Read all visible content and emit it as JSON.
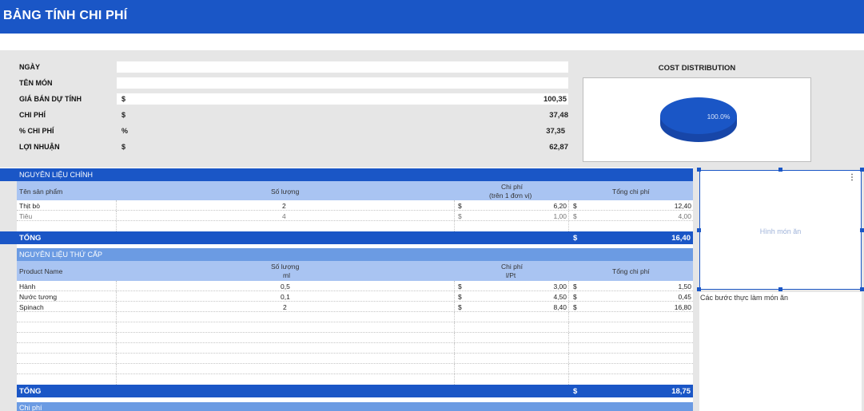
{
  "header": {
    "title": "BẢNG TÍNH CHI PHÍ"
  },
  "summary": {
    "rows": [
      {
        "label": "NGÀY",
        "currency": "",
        "value": ""
      },
      {
        "label": "TÊN MÓN",
        "currency": "",
        "value": ""
      },
      {
        "label": "GIÁ BÁN DỰ TÍNH",
        "currency": "$",
        "value": "100,35"
      },
      {
        "label": "CHI PHÍ",
        "currency": "$",
        "value": "37,48"
      },
      {
        "label": "% CHI PHÍ",
        "currency": "%",
        "value": "37,35"
      },
      {
        "label": "LỢI NHUẬN",
        "currency": "$",
        "value": "62,87"
      }
    ]
  },
  "chart": {
    "title": "COST DISTRIBUTION",
    "slice_label": "100.0%"
  },
  "chart_data": {
    "type": "pie",
    "title": "COST DISTRIBUTION",
    "categories": [
      ""
    ],
    "values": [
      100.0
    ],
    "data_labels": [
      "100.0%"
    ]
  },
  "main_ingredients": {
    "title": "NGUYÊN LIỆU CHÍNH",
    "headers": {
      "name": "Tên sản phẩm",
      "qty": "Số lượng",
      "cost": "Chi phí",
      "cost_sub": "(trên 1 đơn vị)",
      "total": "Tổng chi phí"
    },
    "rows": [
      {
        "name": "Thịt bò",
        "qty": "2",
        "cur1": "$",
        "cost": "6,20",
        "cur2": "$",
        "total": "12,40"
      },
      {
        "name": "Tiêu",
        "qty": "4",
        "cur1": "$",
        "cost": "1,00",
        "cur2": "$",
        "total": "4,00"
      }
    ],
    "total_label": "TỔNG",
    "total_currency": "$",
    "total_value": "16,40"
  },
  "secondary_ingredients": {
    "title": "NGUYÊN LIỆU THỨ CẤP",
    "headers": {
      "name": "Product Name",
      "qty": "Số lượng",
      "qty_sub": "ml",
      "cost": "Chi phí",
      "cost_sub": "l/Pt",
      "total": "Tổng chi phí"
    },
    "rows": [
      {
        "name": "Hành",
        "qty": "0,5",
        "cur1": "$",
        "cost": "3,00",
        "cur2": "$",
        "total": "1,50"
      },
      {
        "name": "Nước tương",
        "qty": "0,1",
        "cur1": "$",
        "cost": "4,50",
        "cur2": "$",
        "total": "0,45"
      },
      {
        "name": "Spinach",
        "qty": "2",
        "cur1": "$",
        "cost": "8,40",
        "cur2": "$",
        "total": "16,80"
      }
    ],
    "total_label": "TỔNG",
    "total_currency": "$",
    "total_value": "18,75"
  },
  "next_section": {
    "title": "Chi phí"
  },
  "side_panel": {
    "image_placeholder": "Hình món ăn",
    "steps_label": "Các bước thực làm món ăn"
  }
}
